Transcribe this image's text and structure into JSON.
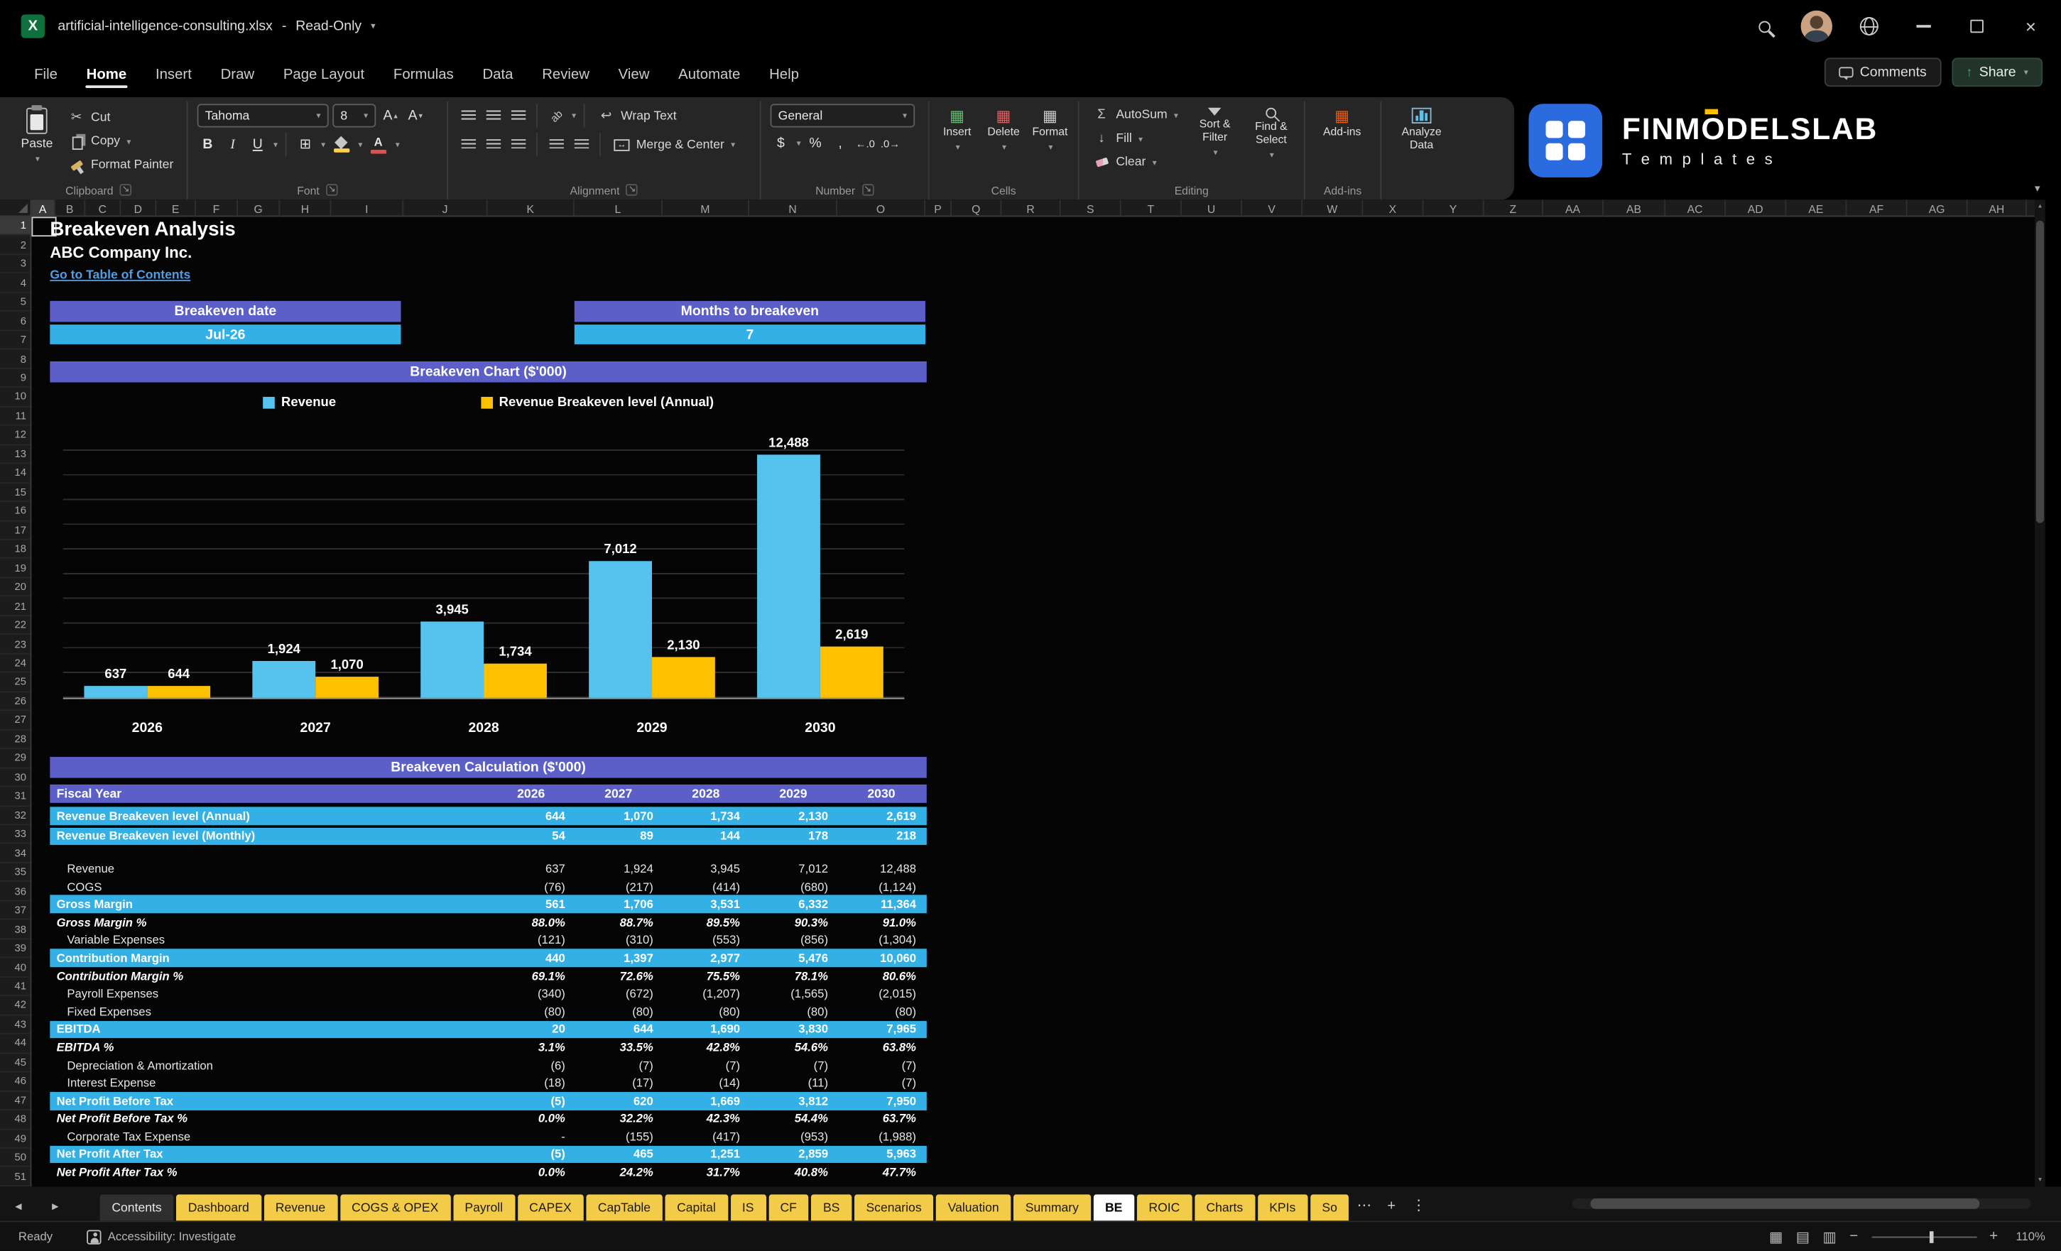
{
  "titlebar": {
    "document_title": "artificial-intelligence-consulting.xlsx",
    "separator": "-",
    "mode": "Read-Only"
  },
  "menubar": {
    "items": [
      "File",
      "Home",
      "Insert",
      "Draw",
      "Page Layout",
      "Formulas",
      "Data",
      "Review",
      "View",
      "Automate",
      "Help"
    ],
    "active_item": "Home",
    "comments": "Comments",
    "share": "Share"
  },
  "ribbon": {
    "clipboard": {
      "label": "Clipboard",
      "paste": "Paste",
      "cut": "Cut",
      "copy": "Copy",
      "format_painter": "Format Painter"
    },
    "font": {
      "label": "Font",
      "font_name": "Tahoma",
      "font_size": "8"
    },
    "alignment": {
      "label": "Alignment",
      "wrap_text": "Wrap Text",
      "merge_center": "Merge & Center",
      "orientation": "ab"
    },
    "number": {
      "label": "Number",
      "format": "General",
      "currency": "$",
      "percent": "%",
      "comma": ",",
      "inc_decimal": "←.0",
      "dec_decimal": ".0→"
    },
    "cells": {
      "label": "Cells",
      "insert": "Insert",
      "delete": "Delete",
      "format": "Format"
    },
    "editing": {
      "label": "Editing",
      "autosum": "AutoSum",
      "fill": "Fill",
      "clear": "Clear",
      "sort_filter": "Sort & Filter",
      "find_select": "Find & Select"
    },
    "addins": {
      "label": "Add-ins",
      "button": "Add-ins",
      "analyze_data": "Analyze Data"
    },
    "brand": {
      "name_pre": "FINM",
      "name_o": "O",
      "name_post": "DELSLAB",
      "subtitle": "T e m p l a t e s"
    }
  },
  "grid": {
    "columns": [
      "A",
      "B",
      "C",
      "D",
      "E",
      "F",
      "G",
      "H",
      "I",
      "J",
      "K",
      "L",
      "M",
      "N",
      "O",
      "P",
      "Q",
      "R",
      "S",
      "T",
      "U",
      "V",
      "W",
      "X",
      "Y",
      "Z",
      "AA",
      "AB",
      "AC",
      "AD",
      "AE",
      "AF",
      "AG",
      "AH"
    ],
    "rows": [
      "1",
      "2",
      "3",
      "4",
      "5",
      "6",
      "7",
      "8",
      "9",
      "10",
      "11",
      "12",
      "13",
      "14",
      "15",
      "16",
      "17",
      "18",
      "19",
      "20",
      "21",
      "22",
      "23",
      "24",
      "25",
      "26",
      "27",
      "28",
      "29",
      "30",
      "31",
      "32",
      "33",
      "34",
      "35",
      "36",
      "37",
      "38",
      "39",
      "40",
      "41",
      "42",
      "43",
      "44",
      "45",
      "46",
      "47",
      "48",
      "49",
      "50",
      "51"
    ]
  },
  "sheet": {
    "title": "Breakeven Analysis",
    "company": "ABC Company Inc.",
    "toc_link": "Go to Table of Contents",
    "breakeven_date": {
      "label": "Breakeven date",
      "value": "Jul-26"
    },
    "months_to_breakeven": {
      "label": "Months to breakeven",
      "value": "7"
    },
    "chart_title": "Breakeven Chart ($'000)",
    "calc_title": "Breakeven Calculation ($'000)"
  },
  "chart_data": {
    "type": "bar",
    "title": "Breakeven Chart ($'000)",
    "categories": [
      "2026",
      "2027",
      "2028",
      "2029",
      "2030"
    ],
    "series": [
      {
        "name": "Revenue",
        "color": "#56C2EE",
        "values": [
          637,
          1924,
          3945,
          7012,
          12488
        ],
        "labels": [
          "637",
          "1,924",
          "3,945",
          "7,012",
          "12,488"
        ]
      },
      {
        "name": "Revenue Breakeven level (Annual)",
        "color": "#FFC000",
        "values": [
          644,
          1070,
          1734,
          2130,
          2619
        ],
        "labels": [
          "644",
          "1,070",
          "1,734",
          "2,130",
          "2,619"
        ]
      }
    ],
    "ylim": [
      0,
      14000
    ],
    "grid": true,
    "legend_position": "top"
  },
  "table": {
    "title": "Breakeven Calculation ($'000)",
    "header": [
      "Fiscal Year",
      "2026",
      "2027",
      "2028",
      "2029",
      "2030"
    ],
    "rows": [
      {
        "label": "Revenue Breakeven level (Annual)",
        "style": "highlight",
        "values": [
          "644",
          "1,070",
          "1,734",
          "2,130",
          "2,619"
        ]
      },
      {
        "label": "Revenue Breakeven level (Monthly)",
        "style": "highlight",
        "values": [
          "54",
          "89",
          "144",
          "178",
          "218"
        ]
      },
      {
        "label": "Revenue",
        "style": "plain",
        "values": [
          "637",
          "1,924",
          "3,945",
          "7,012",
          "12,488"
        ]
      },
      {
        "label": "COGS",
        "style": "plain",
        "values": [
          "(76)",
          "(217)",
          "(414)",
          "(680)",
          "(1,124)"
        ]
      },
      {
        "label": "Gross Margin",
        "style": "highlight",
        "values": [
          "561",
          "1,706",
          "3,531",
          "6,332",
          "11,364"
        ]
      },
      {
        "label": "Gross Margin %",
        "style": "percent",
        "values": [
          "88.0%",
          "88.7%",
          "89.5%",
          "90.3%",
          "91.0%"
        ]
      },
      {
        "label": "Variable Expenses",
        "style": "plain",
        "values": [
          "(121)",
          "(310)",
          "(553)",
          "(856)",
          "(1,304)"
        ]
      },
      {
        "label": "Contribution Margin",
        "style": "highlight",
        "values": [
          "440",
          "1,397",
          "2,977",
          "5,476",
          "10,060"
        ]
      },
      {
        "label": "Contribution Margin %",
        "style": "percent",
        "values": [
          "69.1%",
          "72.6%",
          "75.5%",
          "78.1%",
          "80.6%"
        ]
      },
      {
        "label": "Payroll Expenses",
        "style": "plain",
        "values": [
          "(340)",
          "(672)",
          "(1,207)",
          "(1,565)",
          "(2,015)"
        ]
      },
      {
        "label": "Fixed Expenses",
        "style": "plain",
        "values": [
          "(80)",
          "(80)",
          "(80)",
          "(80)",
          "(80)"
        ]
      },
      {
        "label": "EBITDA",
        "style": "highlight",
        "values": [
          "20",
          "644",
          "1,690",
          "3,830",
          "7,965"
        ]
      },
      {
        "label": "EBITDA %",
        "style": "percent",
        "values": [
          "3.1%",
          "33.5%",
          "42.8%",
          "54.6%",
          "63.8%"
        ]
      },
      {
        "label": "Depreciation & Amortization",
        "style": "plain",
        "values": [
          "(6)",
          "(7)",
          "(7)",
          "(7)",
          "(7)"
        ]
      },
      {
        "label": "Interest Expense",
        "style": "plain",
        "values": [
          "(18)",
          "(17)",
          "(14)",
          "(11)",
          "(7)"
        ]
      },
      {
        "label": "Net Profit Before Tax",
        "style": "highlight",
        "values": [
          "(5)",
          "620",
          "1,669",
          "3,812",
          "7,950"
        ]
      },
      {
        "label": "Net Profit Before Tax %",
        "style": "percent",
        "values": [
          "0.0%",
          "32.2%",
          "42.3%",
          "54.4%",
          "63.7%"
        ]
      },
      {
        "label": "Corporate Tax Expense",
        "style": "plain",
        "values": [
          "-",
          "(155)",
          "(417)",
          "(953)",
          "(1,988)"
        ]
      },
      {
        "label": "Net Profit After Tax",
        "style": "highlight",
        "values": [
          "(5)",
          "465",
          "1,251",
          "2,859",
          "5,963"
        ]
      },
      {
        "label": "Net Profit After Tax %",
        "style": "percent",
        "values": [
          "0.0%",
          "24.2%",
          "31.7%",
          "40.8%",
          "47.7%"
        ]
      }
    ]
  },
  "sheet_tabs": {
    "tabs": [
      {
        "label": "Contents",
        "style": "dark"
      },
      {
        "label": "Dashboard",
        "style": "yellow"
      },
      {
        "label": "Revenue",
        "style": "yellow"
      },
      {
        "label": "COGS & OPEX",
        "style": "yellow"
      },
      {
        "label": "Payroll",
        "style": "yellow"
      },
      {
        "label": "CAPEX",
        "style": "yellow"
      },
      {
        "label": "CapTable",
        "style": "yellow"
      },
      {
        "label": "Capital",
        "style": "yellow"
      },
      {
        "label": "IS",
        "style": "yellow"
      },
      {
        "label": "CF",
        "style": "yellow"
      },
      {
        "label": "BS",
        "style": "yellow"
      },
      {
        "label": "Scenarios",
        "style": "yellow"
      },
      {
        "label": "Valuation",
        "style": "yellow"
      },
      {
        "label": "Summary",
        "style": "yellow"
      },
      {
        "label": "BE",
        "style": "active"
      },
      {
        "label": "ROIC",
        "style": "yellow"
      },
      {
        "label": "Charts",
        "style": "yellow"
      },
      {
        "label": "KPIs",
        "style": "yellow"
      },
      {
        "label": "So",
        "style": "yellow"
      }
    ]
  },
  "statusbar": {
    "ready": "Ready",
    "accessibility": "Accessibility: Investigate",
    "zoom": "110%"
  },
  "colors": {
    "banner_purple": "#5B5FC7",
    "highlight_blue": "#33B1E6",
    "chart_blue": "#56C2EE",
    "chart_yellow": "#FFC000",
    "tab_yellow": "#F2CB49",
    "link_blue": "#4F9FE8",
    "excel_green": "#0E703C"
  }
}
